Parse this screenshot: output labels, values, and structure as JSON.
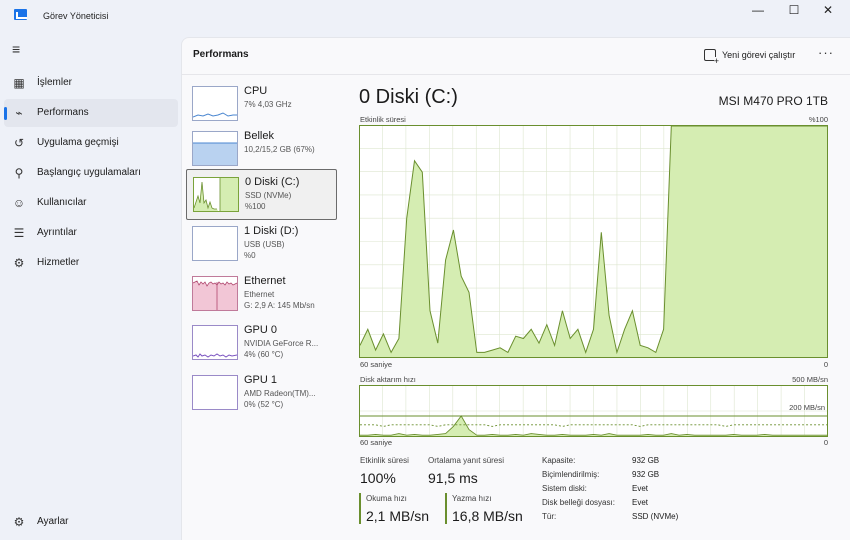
{
  "window": {
    "title": "Görev Yöneticisi",
    "controls": {
      "minimize": "—",
      "maximize": "☐",
      "close": "✕"
    }
  },
  "sidebar": {
    "items": [
      {
        "label": "İşlemler",
        "icon": "processes-icon"
      },
      {
        "label": "Performans",
        "icon": "performance-icon",
        "active": true
      },
      {
        "label": "Uygulama geçmişi",
        "icon": "app-history-icon"
      },
      {
        "label": "Başlangıç uygulamaları",
        "icon": "startup-icon"
      },
      {
        "label": "Kullanıcılar",
        "icon": "users-icon"
      },
      {
        "label": "Ayrıntılar",
        "icon": "details-icon"
      },
      {
        "label": "Hizmetler",
        "icon": "services-icon"
      }
    ],
    "settings_label": "Ayarlar"
  },
  "header": {
    "title": "Performans",
    "run_task_label": "Yeni görevi çalıştır",
    "more_label": "···"
  },
  "devices": [
    {
      "name": "CPU",
      "line1": "7% 4,03 GHz",
      "line2": ""
    },
    {
      "name": "Bellek",
      "line1": "10,2/15,2 GB (67%)",
      "line2": ""
    },
    {
      "name": "0 Diski (C:)",
      "line1": "SSD (NVMe)",
      "line2": "%100",
      "active": true
    },
    {
      "name": "1 Diski (D:)",
      "line1": "USB (USB)",
      "line2": "%0"
    },
    {
      "name": "Ethernet",
      "line1": "Ethernet",
      "line2": "G: 2,9 A: 145 Mb/sn"
    },
    {
      "name": "GPU 0",
      "line1": "NVIDIA GeForce R...",
      "line2": "4% (60 °C)"
    },
    {
      "name": "GPU 1",
      "line1": "AMD Radeon(TM)...",
      "line2": "0% (52 °C)"
    }
  ],
  "detail": {
    "title": "0 Diski (C:)",
    "model": "MSI M470 PRO 1TB",
    "activity_chart": {
      "label": "Etkinlik süresi",
      "max_label": "%100",
      "time_label": "60 saniye",
      "zero_label": "0",
      "values": [
        5,
        12,
        3,
        10,
        2,
        8,
        60,
        85,
        80,
        20,
        6,
        42,
        55,
        35,
        28,
        2,
        2,
        3,
        4,
        2,
        9,
        8,
        12,
        6,
        14,
        5,
        20,
        8,
        12,
        2,
        12,
        54,
        18,
        2,
        12,
        20,
        5,
        4,
        2,
        12,
        100,
        100,
        100,
        100,
        100,
        100,
        100,
        100,
        100,
        100,
        100,
        100,
        100,
        100,
        100,
        100,
        100,
        100,
        100,
        100,
        100
      ]
    },
    "transfer_chart": {
      "label": "Disk aktarım hızı",
      "max_label": "500 MB/sn",
      "ref_label": "200 MB/sn",
      "time_label": "60 saniye",
      "zero_label": "0",
      "write_values": [
        14,
        14,
        14,
        12,
        14,
        14,
        14,
        14,
        14,
        14,
        12,
        14,
        14,
        14,
        14,
        14,
        14,
        12,
        14,
        14,
        14,
        14,
        14,
        14,
        14,
        14,
        12,
        14,
        14,
        14,
        14,
        14,
        14,
        14,
        14,
        14,
        12,
        14,
        14,
        14,
        14,
        14,
        14,
        14,
        14,
        14,
        14,
        12,
        14,
        14,
        14,
        14,
        14,
        14,
        14,
        14,
        14,
        14,
        14,
        14,
        14
      ],
      "read_values": [
        1,
        1,
        2,
        1,
        1,
        3,
        1,
        2,
        1,
        1,
        2,
        3,
        12,
        25,
        8,
        1,
        1,
        2,
        1,
        1,
        2,
        1,
        3,
        2,
        1,
        1,
        2,
        1,
        1,
        1,
        2,
        1,
        3,
        1,
        1,
        1,
        1,
        2,
        1,
        1,
        3,
        1,
        2,
        1,
        1,
        1,
        1,
        1,
        2,
        1,
        1,
        1,
        2,
        1,
        1,
        1,
        1,
        1,
        1,
        1,
        1
      ]
    },
    "stats": {
      "activity_label": "Etkinlik süresi",
      "activity_value": "100%",
      "response_label": "Ortalama yanıt süresi",
      "response_value": "91,5 ms",
      "read_label": "Okuma hızı",
      "read_value": "2,1 MB/sn",
      "write_label": "Yazma hızı",
      "write_value": "16,8 MB/sn"
    },
    "properties": [
      {
        "key": "Kapasite:",
        "value": "932 GB"
      },
      {
        "key": "Biçimlendirilmiş:",
        "value": "932 GB"
      },
      {
        "key": "Sistem diski:",
        "value": "Evet"
      },
      {
        "key": "Disk belleği dosyası:",
        "value": "Evet"
      },
      {
        "key": "Tür:",
        "value": "SSD (NVMe)"
      }
    ]
  },
  "colors": {
    "accent": "#1a73e8",
    "disk_line": "#6a8f2e",
    "disk_fill": "#d5edb2",
    "grid": "#dde6cf"
  }
}
